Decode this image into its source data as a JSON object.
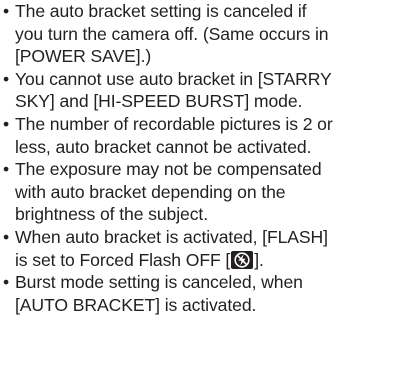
{
  "bullet_glyph": "•",
  "notes": [
    {
      "lines": [
        "The auto bracket setting is canceled if",
        "you turn the camera off. (Same occurs in",
        "[POWER SAVE].)"
      ]
    },
    {
      "lines": [
        "You cannot use auto bracket in [STARRY",
        "SKY] and [HI-SPEED BURST] mode."
      ]
    },
    {
      "lines": [
        "The number of recordable pictures is 2 or",
        "less, auto bracket cannot be activated."
      ]
    },
    {
      "lines": [
        "The exposure may not be compensated",
        "with auto bracket depending on the",
        "brightness of the subject."
      ]
    },
    {
      "lines": [
        "When auto bracket is activated, [FLASH]"
      ],
      "line2_prefix": "is set to Forced Flash OFF [",
      "line2_suffix": "]."
    },
    {
      "lines": [
        "Burst mode setting is canceled, when",
        "[AUTO BRACKET] is activated."
      ]
    }
  ],
  "icons": {
    "flash_off": "forced-flash-off-icon"
  },
  "colors": {
    "text": "#231f20",
    "icon_bg": "#231f20",
    "icon_fg": "#ffffff"
  }
}
